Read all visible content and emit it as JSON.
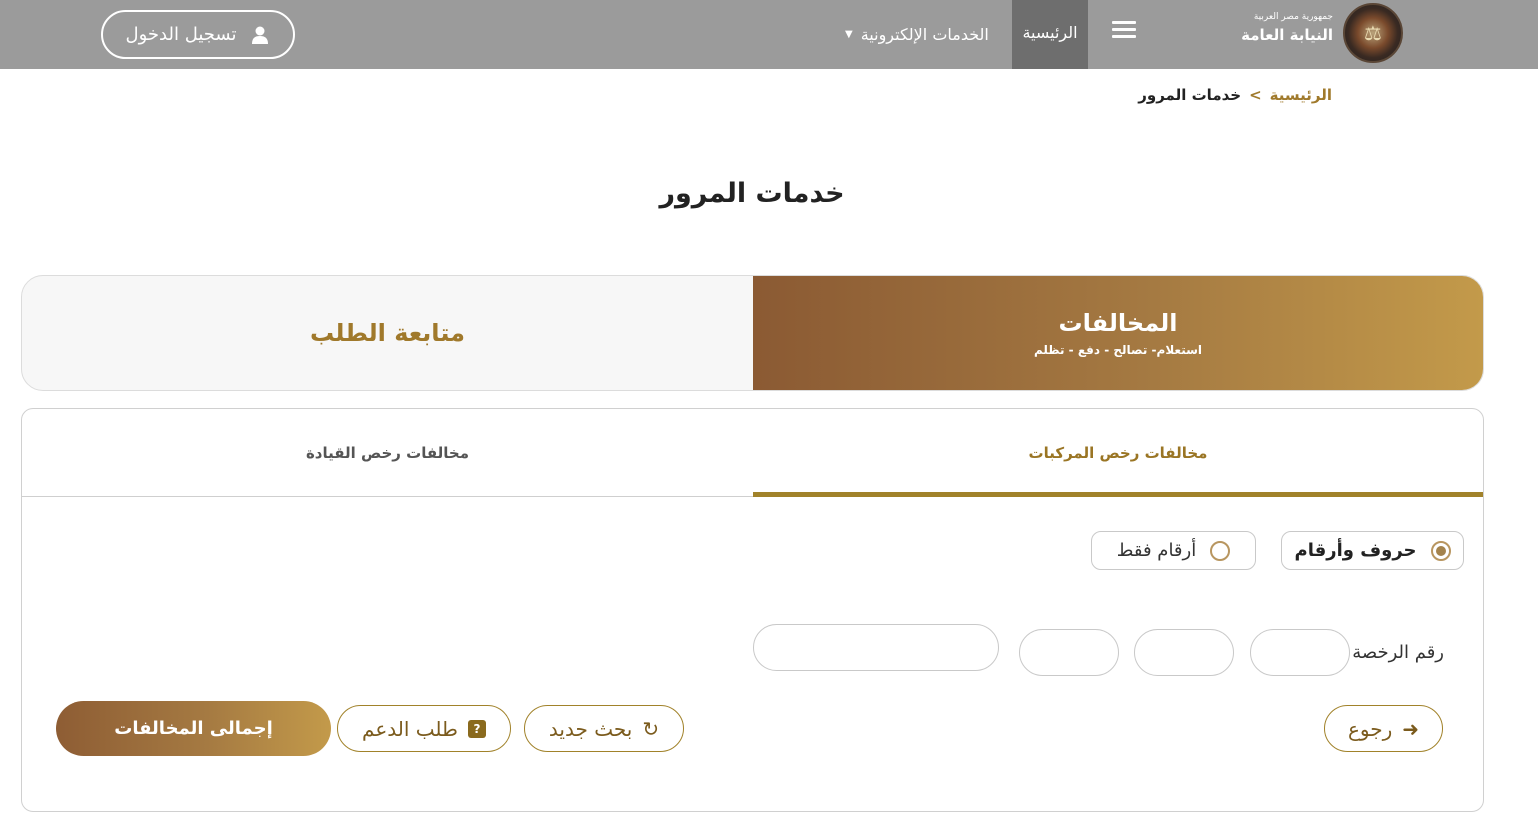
{
  "header": {
    "org_small": "جمهورية مصر العربية",
    "org_name": "النيابة العامة",
    "nav_home": "الرئيسية",
    "nav_services": "الخدمات الإلكترونية",
    "login": "تسجيل الدخول"
  },
  "breadcrumb": {
    "home": "الرئيسية",
    "separator": ">",
    "current": "خدمات المرور"
  },
  "page_title": "خدمات المرور",
  "main_tabs": {
    "violations_title": "المخالفات",
    "violations_sub": "استعلام- تصالح - دفع - تظلم",
    "follow": "متابعة الطلب"
  },
  "sub_tabs": {
    "vehicle": "مخالفات رخص المركبات",
    "driving": "مخالفات رخص القيادة"
  },
  "plate_type": {
    "letters_numbers": "حروف وأرقام",
    "numbers_only": "أرقام فقط",
    "selected": "letters_numbers"
  },
  "plate_label": "رقم الرخصة",
  "buttons": {
    "back": "رجوع",
    "new_search": "بحث جديد",
    "support": "طلب الدعم",
    "total": "إجمالى المخالفات"
  },
  "colors": {
    "header_bg": "#9b9b9b",
    "active_nav_bg": "#6e6e6e",
    "accent": "#a1822a",
    "gradient_start": "#8b5a33",
    "gradient_end": "#c39a4a"
  }
}
